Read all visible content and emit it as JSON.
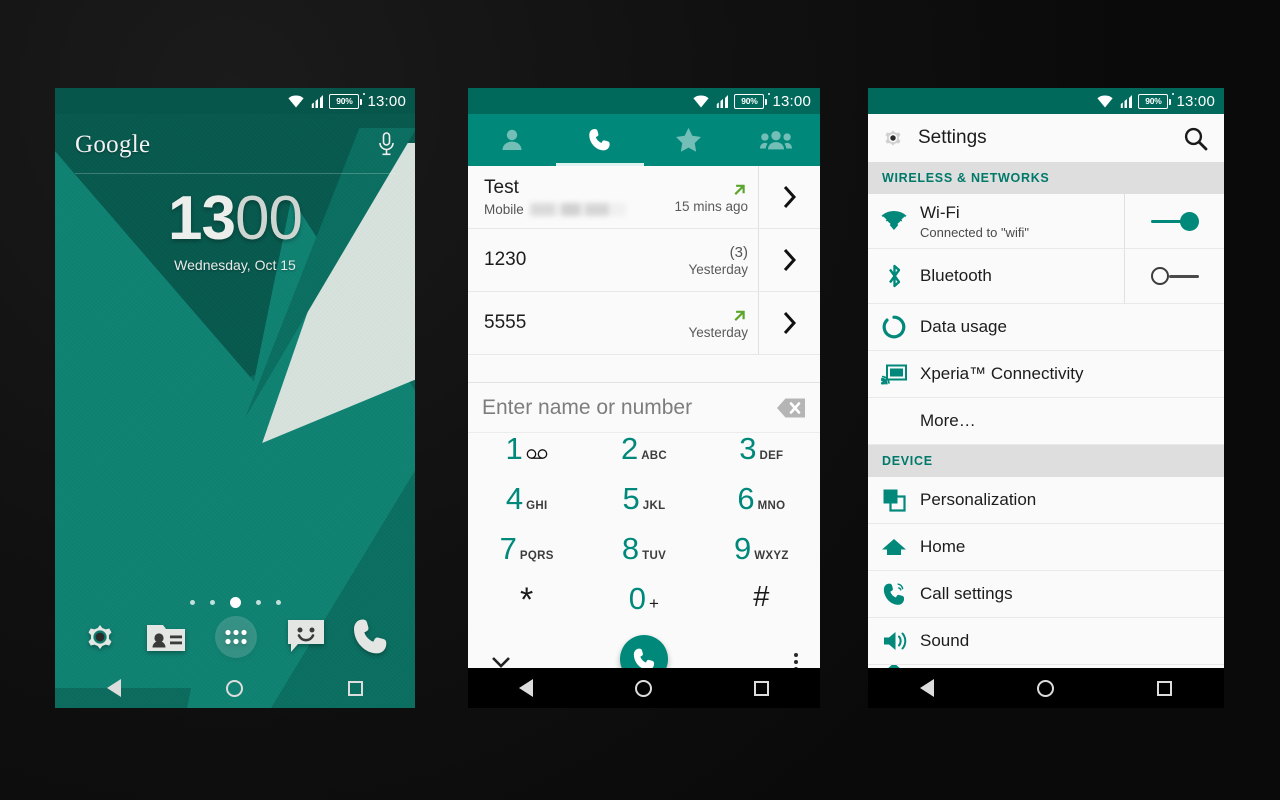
{
  "status_bar": {
    "battery": "90%",
    "clock": "13:00",
    "icons": [
      "wifi-icon",
      "signal-icon",
      "battery-icon"
    ]
  },
  "colors": {
    "teal_dark": "#00695c",
    "teal": "#00897b",
    "teal_accent": "#00796b",
    "green_arrow": "#5ba52c",
    "background": "#0b0b0b"
  },
  "home": {
    "widget": {
      "logo": "Google",
      "mic_icon": "microphone-icon"
    },
    "clock": {
      "hours": "13",
      "minutes": "00",
      "date": "Wednesday, Oct 15"
    },
    "page_dots": {
      "count": 5,
      "active_index": 2
    },
    "dock": [
      {
        "name": "settings",
        "icon": "gear-icon"
      },
      {
        "name": "contacts",
        "icon": "contacts-card-icon"
      },
      {
        "name": "app-drawer",
        "icon": "app-drawer-icon"
      },
      {
        "name": "messaging",
        "icon": "message-smiley-icon"
      },
      {
        "name": "phone",
        "icon": "phone-handset-icon"
      }
    ],
    "nav": [
      "back-icon",
      "home-icon",
      "recents-icon"
    ]
  },
  "dialer": {
    "tabs": [
      {
        "name": "contacts",
        "icon": "person-icon",
        "selected": false
      },
      {
        "name": "call-log",
        "icon": "phone-handset-icon",
        "selected": true
      },
      {
        "name": "favorites",
        "icon": "star-icon",
        "selected": false
      },
      {
        "name": "groups",
        "icon": "people-group-icon",
        "selected": false
      }
    ],
    "call_log": [
      {
        "name": "Test",
        "sub_label": "Mobile",
        "number_redacted": true,
        "when": "15 mins ago",
        "count": "",
        "direction": "outgoing"
      },
      {
        "name": "1230",
        "sub_label": "",
        "number_redacted": false,
        "when": "Yesterday",
        "count": "(3)",
        "direction": "missed-or-incoming"
      },
      {
        "name": "5555",
        "sub_label": "",
        "number_redacted": false,
        "when": "Yesterday",
        "count": "",
        "direction": "outgoing"
      }
    ],
    "input": {
      "placeholder": "Enter name or number",
      "value": "",
      "clear_icon": "backspace-icon"
    },
    "keypad": [
      [
        {
          "digit": "1",
          "letters": "",
          "sub_icon": "voicemail-icon"
        },
        {
          "digit": "2",
          "letters": "ABC"
        },
        {
          "digit": "3",
          "letters": "DEF"
        }
      ],
      [
        {
          "digit": "4",
          "letters": "GHI"
        },
        {
          "digit": "5",
          "letters": "JKL"
        },
        {
          "digit": "6",
          "letters": "MNO"
        }
      ],
      [
        {
          "digit": "7",
          "letters": "PQRS"
        },
        {
          "digit": "8",
          "letters": "TUV"
        },
        {
          "digit": "9",
          "letters": "WXYZ"
        }
      ],
      [
        {
          "digit": "*",
          "letters": "",
          "dark": true
        },
        {
          "digit": "0",
          "letters": "+"
        },
        {
          "digit": "#",
          "letters": "",
          "dark": true
        }
      ]
    ],
    "actions": {
      "collapse_icon": "chevron-down-icon",
      "call_icon": "phone-handset-icon",
      "overflow_icon": "kebab-menu-icon"
    },
    "nav": [
      "back-icon",
      "home-icon",
      "recents-icon"
    ]
  },
  "settings": {
    "header": {
      "title": "Settings",
      "gear_icon": "gear-icon",
      "search_icon": "search-icon"
    },
    "sections": [
      {
        "header": "WIRELESS & NETWORKS",
        "items": [
          {
            "label": "Wi-Fi",
            "sub": "Connected to \"wifi\"",
            "icon": "wifi-icon",
            "toggle": "on"
          },
          {
            "label": "Bluetooth",
            "sub": "",
            "icon": "bluetooth-icon",
            "toggle": "off"
          },
          {
            "label": "Data usage",
            "sub": "",
            "icon": "data-usage-icon",
            "toggle": ""
          },
          {
            "label": "Xperia™ Connectivity",
            "sub": "",
            "icon": "cast-screen-icon",
            "toggle": ""
          },
          {
            "label": "More…",
            "sub": "",
            "icon": "",
            "toggle": ""
          }
        ]
      },
      {
        "header": "DEVICE",
        "items": [
          {
            "label": "Personalization",
            "sub": "",
            "icon": "layers-icon",
            "toggle": ""
          },
          {
            "label": "Home",
            "sub": "",
            "icon": "home-roof-icon",
            "toggle": ""
          },
          {
            "label": "Call settings",
            "sub": "",
            "icon": "call-settings-icon",
            "toggle": ""
          },
          {
            "label": "Sound",
            "sub": "",
            "icon": "speaker-icon",
            "toggle": ""
          }
        ]
      }
    ],
    "nav": [
      "back-icon",
      "home-icon",
      "recents-icon"
    ]
  }
}
